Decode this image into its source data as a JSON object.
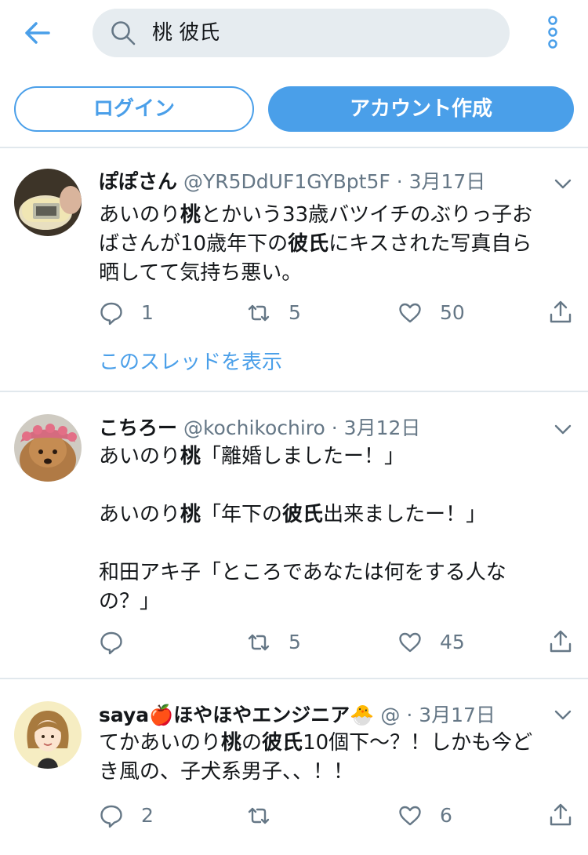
{
  "search": {
    "query": "桃 彼氏"
  },
  "auth": {
    "login_label": "ログイン",
    "signup_label": "アカウント作成"
  },
  "colors": {
    "accent": "#4a9fe9",
    "text": "#14171a",
    "meta": "#657786",
    "divider": "#e1e8ed"
  },
  "tweets": [
    {
      "name": "ぽぽさん",
      "handle": "@YR5DdUF1GYBpt5F",
      "date": "· 3月17日",
      "body": [
        [
          {
            "t": "あいのり"
          },
          {
            "t": "桃",
            "b": true
          },
          {
            "t": "とかいう33歳バツイチのぶりっ子お"
          }
        ],
        [
          {
            "t": "ばさんが10歳年下の"
          },
          {
            "t": "彼氏",
            "b": true
          },
          {
            "t": "にキスされた写真自ら"
          }
        ],
        [
          {
            "t": "晒してて気持ち悪い。"
          }
        ]
      ],
      "replies": "1",
      "retweets": "5",
      "likes": "50",
      "thread_link": "このスレッドを表示"
    },
    {
      "name": "こちろー",
      "handle": "@kochikochiro",
      "date": "· 3月12日",
      "body": [
        [
          {
            "t": "あいのり"
          },
          {
            "t": "桃",
            "b": true
          },
          {
            "t": "「離婚しましたー！」"
          }
        ],
        [],
        [
          {
            "t": "あいのり"
          },
          {
            "t": "桃",
            "b": true
          },
          {
            "t": "「年下の"
          },
          {
            "t": "彼氏",
            "b": true
          },
          {
            "t": "出来ましたー！」"
          }
        ],
        [],
        [
          {
            "t": "和田アキ子「ところであなたは何をする人な"
          }
        ],
        [
          {
            "t": "の？」"
          }
        ]
      ],
      "replies": "",
      "retweets": "5",
      "likes": "45"
    },
    {
      "name": "saya🍎ほやほやエンジニア🐣",
      "handle": "@",
      "date": "· 3月17日",
      "body": [
        [
          {
            "t": "てかあいのり"
          },
          {
            "t": "桃",
            "b": true
          },
          {
            "t": "の"
          },
          {
            "t": "彼氏",
            "b": true
          },
          {
            "t": "10個下〜？！しかも今ど"
          }
        ],
        [
          {
            "t": "き風の、子犬系男子、、！！"
          }
        ]
      ],
      "replies": "2",
      "retweets": "",
      "likes": "6"
    }
  ],
  "icons": {
    "back": "arrow-left-icon",
    "search": "search-icon",
    "more": "more-vertical-icon",
    "reply": "reply-icon",
    "retweet": "retweet-icon",
    "like": "heart-icon",
    "share": "share-icon",
    "caret": "chevron-down-icon"
  }
}
